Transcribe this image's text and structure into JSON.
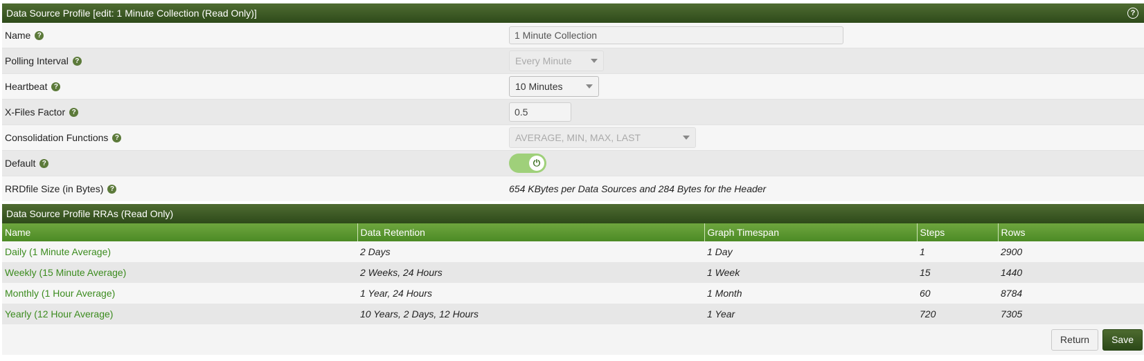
{
  "header": {
    "title": "Data Source Profile [edit: 1 Minute Collection (Read Only)]",
    "help_icon": "question-circle-icon"
  },
  "form": {
    "name": {
      "label": "Name",
      "value": "1 Minute Collection"
    },
    "polling_interval": {
      "label": "Polling Interval",
      "value": "Every Minute"
    },
    "heartbeat": {
      "label": "Heartbeat",
      "value": "10 Minutes"
    },
    "xff": {
      "label": "X-Files Factor",
      "value": "0.5"
    },
    "consolidation": {
      "label": "Consolidation Functions",
      "value": "AVERAGE, MIN, MAX, LAST"
    },
    "default": {
      "label": "Default",
      "on": true
    },
    "rrdfile": {
      "label": "RRDfile Size (in Bytes)",
      "value": "654 KBytes per Data Sources and 284 Bytes for the Header"
    }
  },
  "rra": {
    "title": "Data Source Profile RRAs (Read Only)",
    "columns": [
      "Name",
      "Data Retention",
      "Graph Timespan",
      "Steps",
      "Rows"
    ],
    "rows": [
      {
        "name": "Daily (1 Minute Average)",
        "retention": "2 Days",
        "timespan": "1 Day",
        "steps": "1",
        "rows": "2900"
      },
      {
        "name": "Weekly (15 Minute Average)",
        "retention": "2 Weeks, 24 Hours",
        "timespan": "1 Week",
        "steps": "15",
        "rows": "1440"
      },
      {
        "name": "Monthly (1 Hour Average)",
        "retention": "1 Year, 24 Hours",
        "timespan": "1 Month",
        "steps": "60",
        "rows": "8784"
      },
      {
        "name": "Yearly (12 Hour Average)",
        "retention": "10 Years, 2 Days, 12 Hours",
        "timespan": "1 Year",
        "steps": "720",
        "rows": "7305"
      }
    ]
  },
  "buttons": {
    "return": "Return",
    "save": "Save"
  },
  "colors": {
    "header": "#2e4a1a",
    "table_header": "#5a962e",
    "link": "#3b8b1e"
  }
}
